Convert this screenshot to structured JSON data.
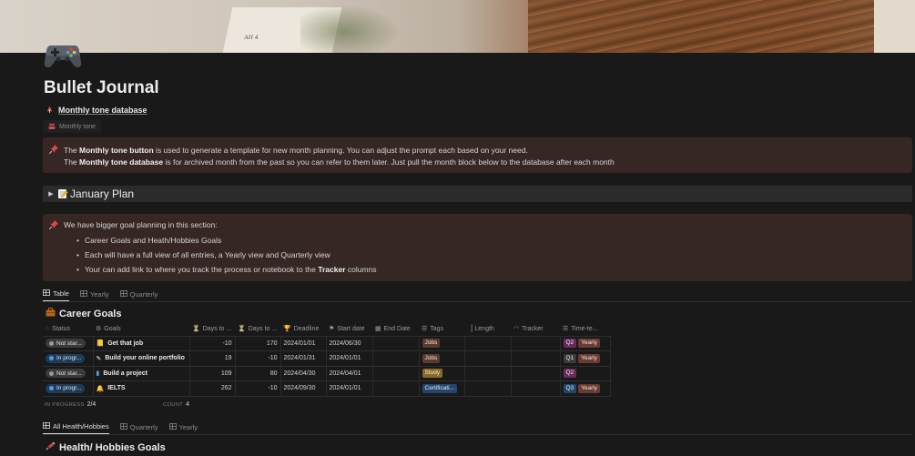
{
  "page": {
    "title": "Bullet Journal",
    "icon": "game-controller-icon"
  },
  "database_link": {
    "label": "Monthly tone database",
    "icon": "pin-icon"
  },
  "tone_button": {
    "label": "Monthly tone",
    "icon": "people-icon"
  },
  "callout_top": {
    "icon": "pushpin-icon",
    "line1_pre": "The ",
    "line1_bold": "Monthly tone button",
    "line1_post": " is used to generate a template for new month planning. You can adjust the prompt each based on your need.",
    "line2_pre": "The ",
    "line2_bold": "Monthly tone database",
    "line2_post": " is for archived month from the past so you can refer to them later. Just pull the month block below to the database after each month"
  },
  "toggle": {
    "label": "January Plan",
    "icon": "memo-icon"
  },
  "callout_goals": {
    "icon": "pushpin-icon",
    "lead": "We have bigger goal planning in this section:",
    "item1": "Career Goals and Heath/Hobbies Goals",
    "item2": "Each will have a full view of all entries, a Yearly view and Quarterly view",
    "item3_pre": "Your can add link to where you track the process or notebook to the ",
    "item3_bold": "Tracker",
    "item3_post": " columns"
  },
  "career_views": {
    "table": "Table",
    "yearly": "Yearly",
    "quarterly": "Quarterly"
  },
  "career": {
    "title": "Career Goals",
    "icon": "briefcase-icon",
    "columns": {
      "status": "Status",
      "goals": "Goals",
      "days_to_1": "Days to ...",
      "days_to_2": "Days to ...",
      "deadline": "Deadline",
      "start": "Start date",
      "end": "End Date",
      "tags": "Tags",
      "length": "Length",
      "tracker": "Tracker",
      "time": "Time-te..."
    },
    "rows": [
      {
        "status": "Not star...",
        "goal": "Get that job",
        "d1": "-10",
        "d2": "170",
        "deadline": "2024/01/01",
        "start": "2024/06/30",
        "tag": "Jobs",
        "q": "Q2",
        "y": "Yearly"
      },
      {
        "status": "In progr...",
        "goal": "Build your online portfolio",
        "d1": "19",
        "d2": "-10",
        "deadline": "2024/01/31",
        "start": "2024/01/01",
        "tag": "Jobs",
        "q": "Q1",
        "y": "Yearly"
      },
      {
        "status": "Not star...",
        "goal": "Build a project",
        "d1": "109",
        "d2": "80",
        "deadline": "2024/04/30",
        "start": "2024/04/01",
        "tag": "Study",
        "q": "Q2",
        "y": ""
      },
      {
        "status": "In progr...",
        "goal": "IELTS",
        "d1": "262",
        "d2": "-10",
        "deadline": "2024/09/30",
        "start": "2024/01/01",
        "tag": "Certificati...",
        "q": "Q3",
        "y": "Yearly"
      }
    ],
    "footer": {
      "in_progress_label": "IN PROGRESS",
      "in_progress_value": "2/4",
      "count_label": "COUNT",
      "count_value": "4"
    }
  },
  "health_views": {
    "all": "All Health/Hobbies",
    "quarterly": "Quarterly",
    "yearly": "Yearly"
  },
  "health": {
    "title": "Health/ Hobbies Goals",
    "icon": "syringe-icon"
  },
  "colors": {
    "callout_bg": "#362624",
    "tag_jobs": "#5c3a2e",
    "tag_study": "#8a6a22",
    "tag_cert": "#24466e",
    "q2": "#6b2a5a",
    "q1": "#3b3b3b",
    "q3": "#24466e",
    "yearly": "#6a3b2e"
  }
}
